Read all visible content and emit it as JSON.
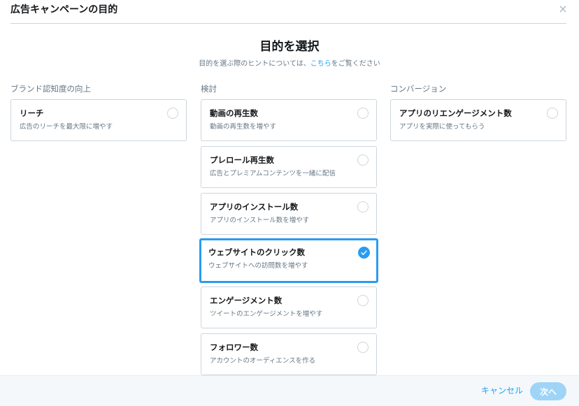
{
  "modal": {
    "title": "広告キャンペーンの目的",
    "close_label": "×"
  },
  "heading": {
    "title": "目的を選択",
    "hint_before": "目的を選ぶ際のヒントについては、",
    "hint_link": "こちら",
    "hint_after": "をご覧ください"
  },
  "columns": [
    {
      "title": "ブランド認知度の向上",
      "cards": [
        {
          "title": "リーチ",
          "desc": "広告のリーチを最大限に増やす",
          "selected": false
        }
      ]
    },
    {
      "title": "検討",
      "cards": [
        {
          "title": "動画の再生数",
          "desc": "動画の再生数を増やす",
          "selected": false
        },
        {
          "title": "プレロール再生数",
          "desc": "広告とプレミアムコンテンツを一緒に配信",
          "selected": false
        },
        {
          "title": "アプリのインストール数",
          "desc": "アプリのインストール数を増やす",
          "selected": false
        },
        {
          "title": "ウェブサイトのクリック数",
          "desc": "ウェブサイトへの訪問数を増やす",
          "selected": true
        },
        {
          "title": "エンゲージメント数",
          "desc": "ツイートのエンゲージメントを増やす",
          "selected": false
        },
        {
          "title": "フォロワー数",
          "desc": "アカウントのオーディエンスを作る",
          "selected": false
        }
      ]
    },
    {
      "title": "コンバージョン",
      "cards": [
        {
          "title": "アプリのリエンゲージメント数",
          "desc": "アプリを実際に使ってもらう",
          "selected": false
        }
      ]
    }
  ],
  "footer": {
    "cancel_label": "キャンセル",
    "next_label": "次へ"
  },
  "colors": {
    "accent": "#1da1f2",
    "selected_border": "#2b9bf0",
    "next_disabled": "#9fd4f7"
  }
}
